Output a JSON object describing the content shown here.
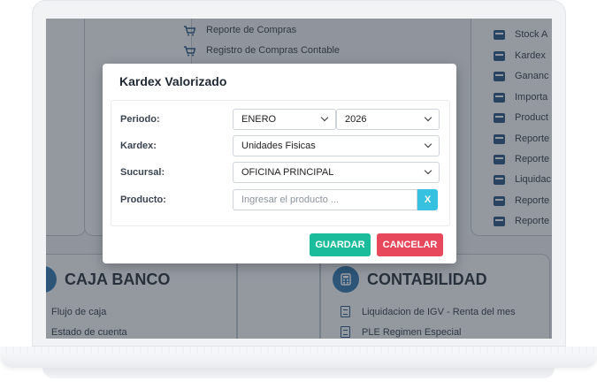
{
  "background_menus": {
    "compras_items": [
      {
        "label": "Reporte de Compras",
        "icon": "cart-icon"
      },
      {
        "label": "Registro de Compras Contable",
        "icon": "cart-icon"
      }
    ],
    "reportes_items": [
      {
        "label": "Stock A",
        "icon": "box-icon"
      },
      {
        "label": "Kardex",
        "icon": "box-icon"
      },
      {
        "label": "Gananc",
        "icon": "box-icon"
      },
      {
        "label": "Importa",
        "icon": "box-icon"
      },
      {
        "label": "Product",
        "icon": "box-icon"
      },
      {
        "label": "Reporte",
        "icon": "box-icon"
      },
      {
        "label": "Reporte",
        "icon": "box-icon"
      },
      {
        "label": "Liquidac",
        "icon": "box-icon"
      },
      {
        "label": "Reporte",
        "icon": "box-icon"
      },
      {
        "label": "Reporte",
        "icon": "box-icon"
      }
    ],
    "caja_banco": {
      "title": "CAJA BANCO",
      "items": [
        "Flujo de caja",
        "Estado de cuenta"
      ]
    },
    "contabilidad": {
      "title": "CONTABILIDAD",
      "items": [
        "Liquidacion de IGV - Renta del mes",
        "PLE Regimen Especial"
      ]
    }
  },
  "modal": {
    "title": "Kardex Valorizado",
    "fields": {
      "periodo": {
        "label": "Periodo:",
        "month": "ENERO",
        "year": "2026"
      },
      "kardex": {
        "label": "Kardex:",
        "value": "Unidades Fisicas"
      },
      "sucursal": {
        "label": "Sucursal:",
        "value": "OFICINA PRINCIPAL"
      },
      "producto": {
        "label": "Producto:",
        "placeholder": "Ingresar el producto ...",
        "clear_label": "X"
      }
    },
    "buttons": {
      "save": "GUARDAR",
      "cancel": "CANCELAR"
    }
  },
  "colors": {
    "save_button": "#1abc9c",
    "cancel_button": "#e8485b",
    "clear_button": "#35c1df",
    "section_icon": "#2a6ea8"
  }
}
